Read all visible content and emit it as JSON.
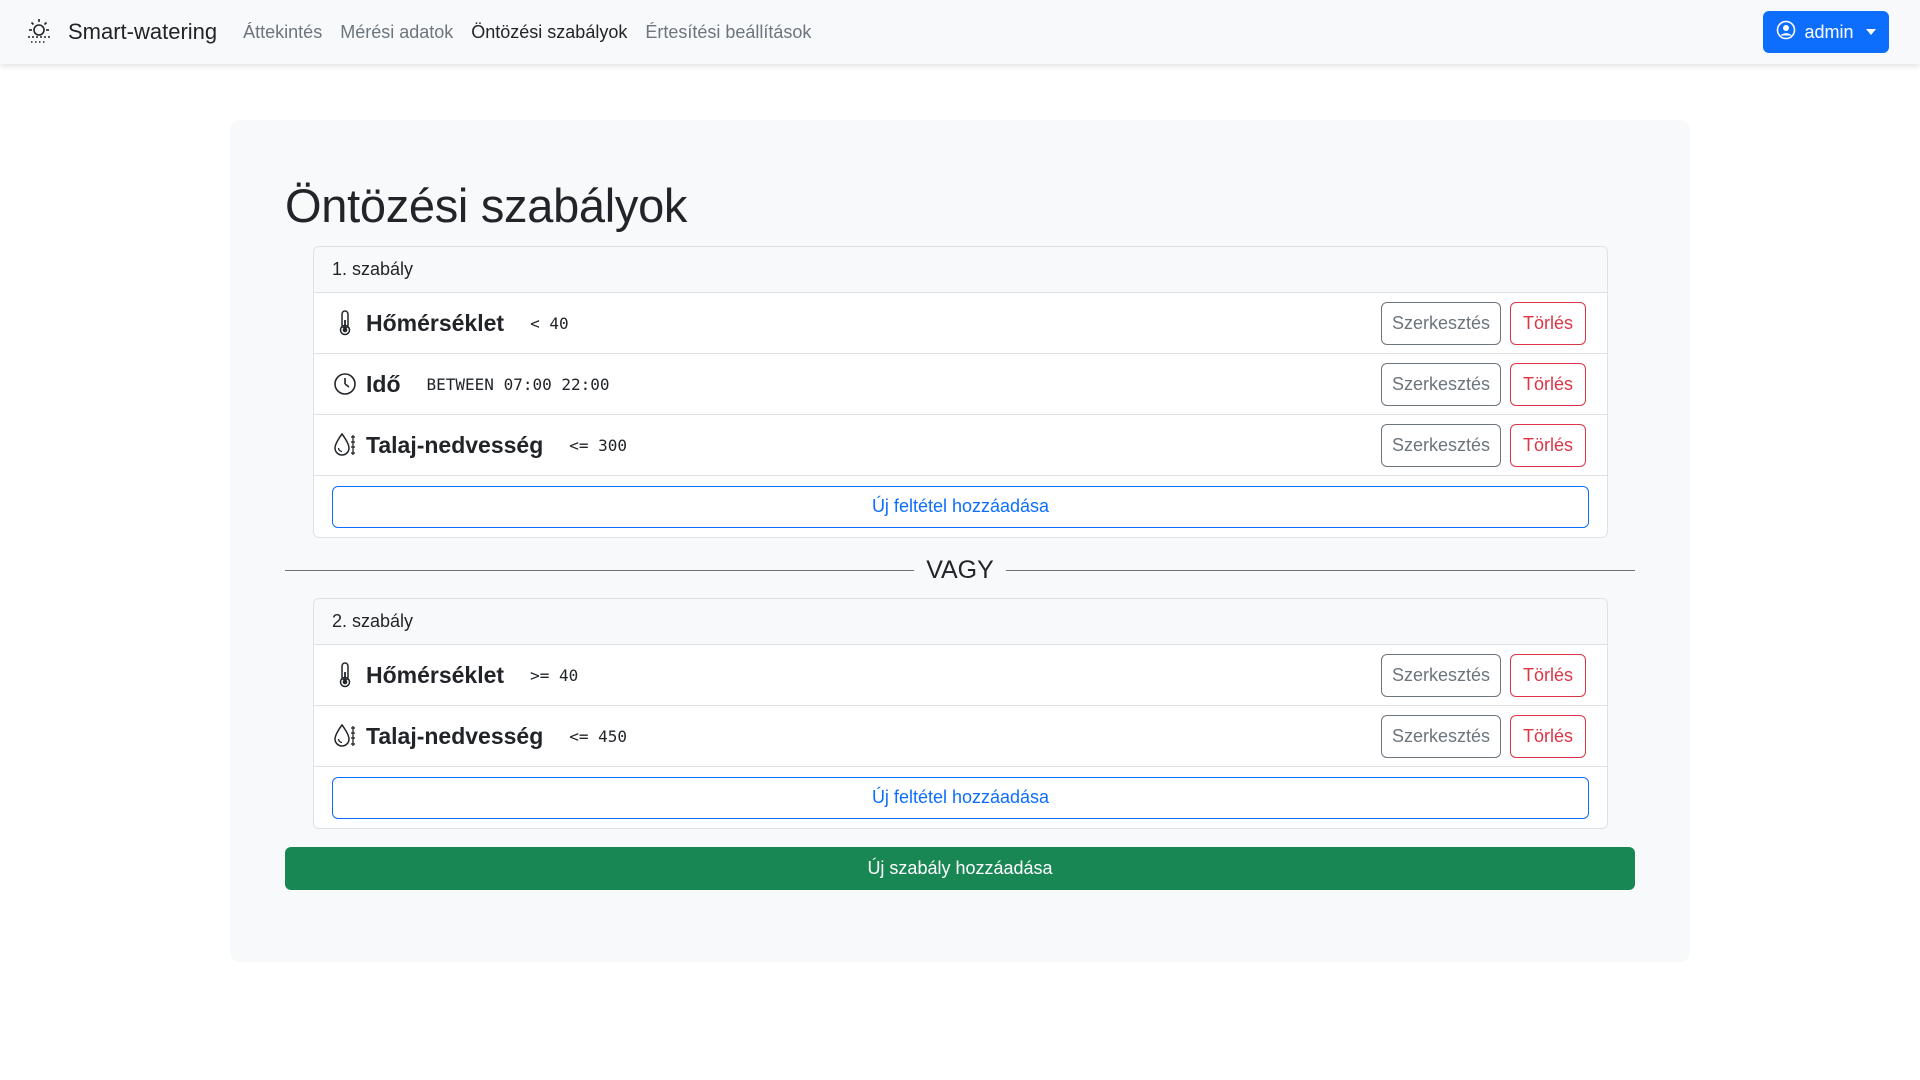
{
  "navbar": {
    "brand": "Smart-watering",
    "brand_icon": "sun-icon",
    "links": [
      {
        "label": "Áttekintés",
        "active": false
      },
      {
        "label": "Mérési adatok",
        "active": false
      },
      {
        "label": "Öntözési szabályok",
        "active": true
      },
      {
        "label": "Értesítési beállítások",
        "active": false
      }
    ],
    "user": {
      "label": "admin",
      "icon": "user-circle-icon"
    }
  },
  "page": {
    "title": "Öntözési szabályok"
  },
  "rules": [
    {
      "header": "1. szabály",
      "conditions": [
        {
          "icon": "thermometer-icon",
          "name": "Hőmérséklet",
          "expr": "< 40"
        },
        {
          "icon": "clock-icon",
          "name": "Idő",
          "expr": "BETWEEN 07:00 22:00"
        },
        {
          "icon": "moisture-icon",
          "name": "Talaj-nedvesség",
          "expr": "<= 300"
        }
      ],
      "add_condition_label": "Új feltétel hozzáadása"
    },
    {
      "header": "2. szabály",
      "conditions": [
        {
          "icon": "thermometer-icon",
          "name": "Hőmérséklet",
          "expr": ">= 40"
        },
        {
          "icon": "moisture-icon",
          "name": "Talaj-nedvesség",
          "expr": "<= 450"
        }
      ],
      "add_condition_label": "Új feltétel hozzáadása"
    }
  ],
  "labels": {
    "edit": "Szerkesztés",
    "delete": "Törlés",
    "or": "VAGY",
    "new_rule": "Új szabály hozzáadása"
  },
  "colors": {
    "primary": "#0d6efd",
    "danger": "#dc3545",
    "success": "#198754",
    "secondary": "#6c757d"
  }
}
